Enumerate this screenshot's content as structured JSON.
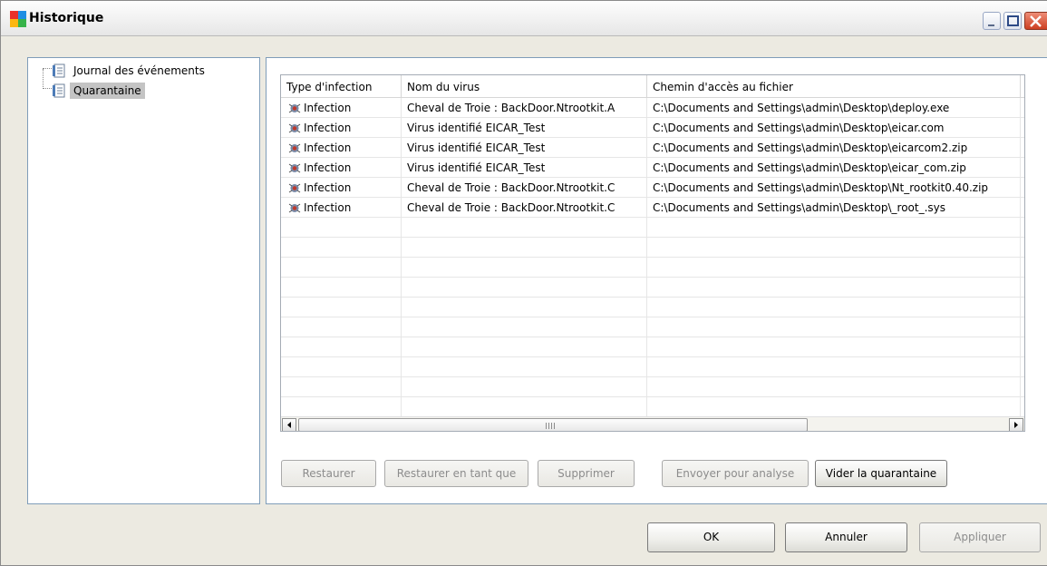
{
  "window": {
    "title": "Historique"
  },
  "tree": {
    "items": [
      {
        "label": "Journal des événements",
        "selected": false
      },
      {
        "label": "Quarantaine",
        "selected": true
      }
    ]
  },
  "table": {
    "columns": [
      "Type d'infection",
      "Nom du virus",
      "Chemin d'accès au fichier"
    ],
    "rows": [
      [
        "Infection",
        "Cheval de Troie : BackDoor.Ntrootkit.A",
        "C:\\Documents and Settings\\admin\\Desktop\\deploy.exe"
      ],
      [
        "Infection",
        "Virus identifié EICAR_Test",
        "C:\\Documents and Settings\\admin\\Desktop\\eicar.com"
      ],
      [
        "Infection",
        "Virus identifié EICAR_Test",
        "C:\\Documents and Settings\\admin\\Desktop\\eicarcom2.zip"
      ],
      [
        "Infection",
        "Virus identifié EICAR_Test",
        "C:\\Documents and Settings\\admin\\Desktop\\eicar_com.zip"
      ],
      [
        "Infection",
        "Cheval de Troie : BackDoor.Ntrootkit.C",
        "C:\\Documents and Settings\\admin\\Desktop\\Nt_rootkit0.40.zip"
      ],
      [
        "Infection",
        "Cheval de Troie : BackDoor.Ntrootkit.C",
        "C:\\Documents and Settings\\admin\\Desktop\\_root_.sys"
      ]
    ],
    "empty_rows": 11
  },
  "quarantine_buttons": {
    "restore": "Restaurer",
    "restore_as": "Restaurer en tant que",
    "delete": "Supprimer",
    "send": "Envoyer pour analyse",
    "empty": "Vider la quarantaine"
  },
  "dialog_buttons": {
    "ok": "OK",
    "cancel": "Annuler",
    "apply": "Appliquer"
  }
}
